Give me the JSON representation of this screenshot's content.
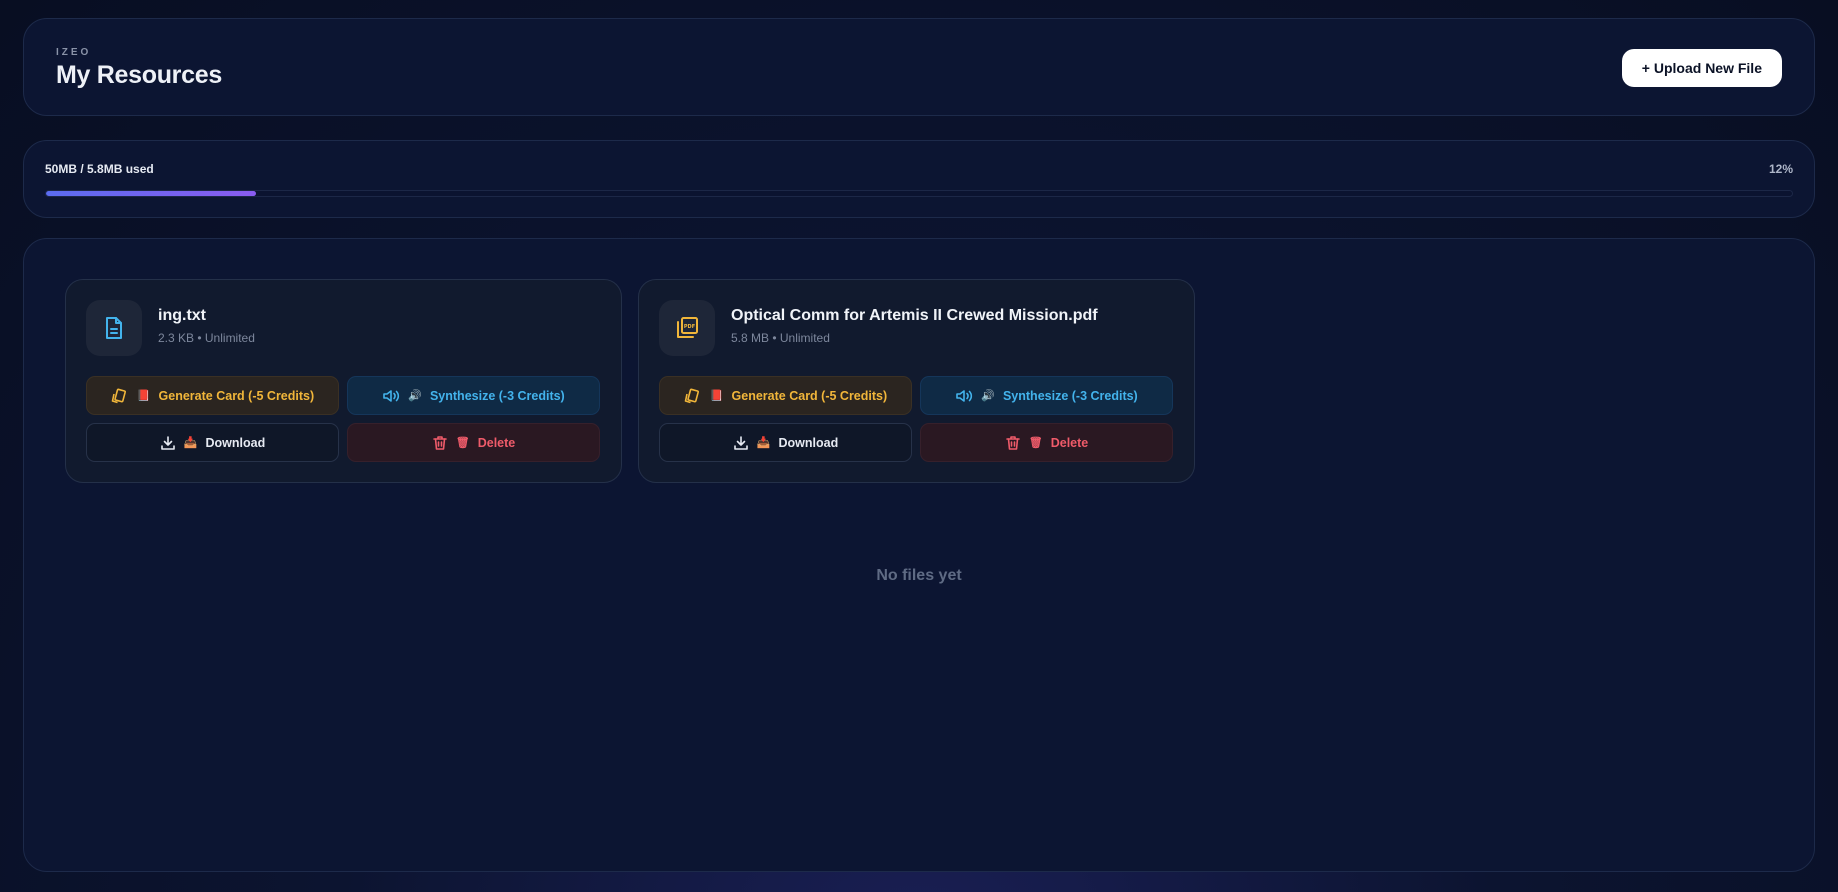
{
  "header": {
    "brand": "IZEO",
    "title": "My Resources",
    "upload_label": "+ Upload New File"
  },
  "storage": {
    "label": "50MB / 5.8MB used",
    "percent_label": "12%",
    "fill_fraction": 0.12,
    "accent_start": "#5b6cf0",
    "accent_end": "#8a5cf0"
  },
  "files": [
    {
      "name": "ing.txt",
      "meta": "2.3 KB • Unlimited",
      "icon": "text-file-icon",
      "generate_label": "Generate Card (-5 Credits)",
      "generate_emoji": "📕",
      "synthesize_label": "Synthesize (-3 Credits)",
      "synthesize_emoji": "🔊",
      "download_label": "Download",
      "download_emoji": "📥",
      "delete_label": "Delete",
      "delete_emoji": "🗑"
    },
    {
      "name": "Optical Comm for Artemis II Crewed Mission.pdf",
      "meta": "5.8 MB • Unlimited",
      "icon": "pdf-file-icon",
      "generate_label": "Generate Card (-5 Credits)",
      "generate_emoji": "📕",
      "synthesize_label": "Synthesize (-3 Credits)",
      "synthesize_emoji": "🔊",
      "download_label": "Download",
      "download_emoji": "📥",
      "delete_label": "Delete",
      "delete_emoji": "🗑"
    }
  ],
  "empty_state": "No files yet",
  "colors": {
    "generate": "#f1b63a",
    "synthesize": "#43b3ec",
    "delete": "#ef5b6a",
    "text_icon": "#43b3ec",
    "pdf_icon": "#f1b63a"
  }
}
